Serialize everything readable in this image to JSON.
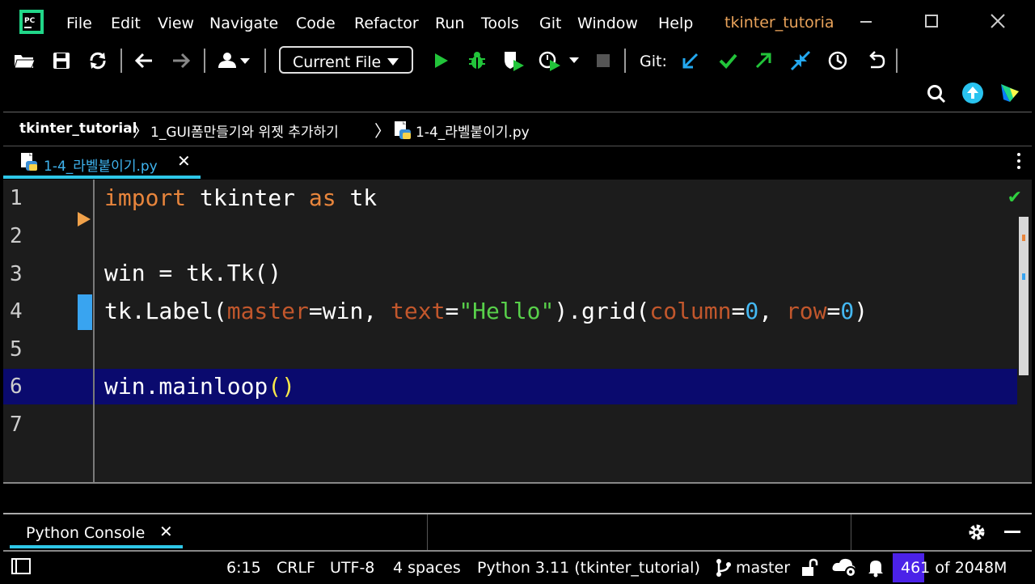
{
  "menu": {
    "items": [
      "File",
      "Edit",
      "View",
      "Navigate",
      "Code",
      "Refactor",
      "Run",
      "Tools",
      "Git",
      "Window",
      "Help"
    ],
    "project_title": "tkinter_tutoria"
  },
  "toolbar": {
    "run_config": "Current File",
    "git_label": "Git:",
    "icons": [
      "open-folder-icon",
      "save-icon",
      "sync-icon",
      "back-icon",
      "forward-icon",
      "user-icon",
      "run-icon",
      "debug-icon",
      "coverage-icon",
      "profile-icon",
      "stop-icon",
      "git-update-icon",
      "git-commit-icon",
      "git-push-icon",
      "git-pull-icon",
      "history-icon",
      "rollback-icon",
      "search-icon",
      "update-icon",
      "plugin-icon"
    ]
  },
  "breadcrumb": {
    "project": "tkinter_tutorial",
    "folder": "1_GUI폼만들기와 위젯 추가하기",
    "file": "1-4_라벨붙이기.py"
  },
  "tab": {
    "label": "1-4_라벨붙이기.py"
  },
  "editor": {
    "line_numbers": [
      "1",
      "2",
      "3",
      "4",
      "5",
      "6",
      "7"
    ],
    "lines": [
      {
        "a": "import",
        "b": " tkinter ",
        "c": "as",
        "d": " tk"
      },
      {},
      {
        "t": "win = tk.Tk()"
      },
      {
        "p1": "tk.Label(",
        "k1": "master",
        "p2": "=win, ",
        "k2": "text",
        "p3": "=",
        "s": "\"Hello\"",
        "p4": ").grid(",
        "k3": "column",
        "p5": "=",
        "n1": "0",
        "p6": ", ",
        "k4": "row",
        "p7": "=",
        "n2": "0",
        "p8": ")"
      },
      {},
      {
        "a": "win.mainloop",
        "b": "()"
      },
      {}
    ],
    "current_line": 6
  },
  "console": {
    "tab_label": "Python Console"
  },
  "status": {
    "position": "6:15",
    "line_sep": "CRLF",
    "encoding": "UTF-8",
    "indent": "4 spaces",
    "interpreter": "Python 3.11 (tkinter_tutorial)",
    "branch": "master",
    "memory_used": "461",
    "memory_of": "of",
    "memory_total": "2048M",
    "memory_fraction": 0.225
  },
  "colors": {
    "accent": "#2ec7e8",
    "keyword": "#e8853c",
    "string": "#58d04a",
    "number": "#44b8f2",
    "highlight": "#0a0a6e"
  }
}
